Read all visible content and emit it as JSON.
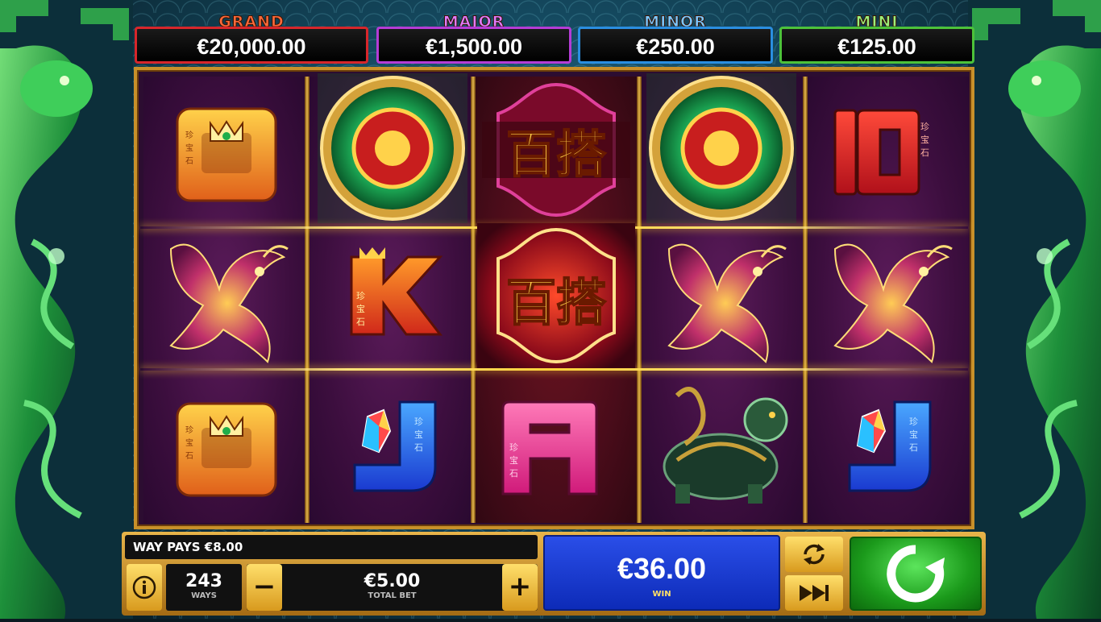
{
  "jackpots": [
    {
      "name": "GRAND",
      "value": "€20,000.00",
      "color": "#d7262b"
    },
    {
      "name": "MAJOR",
      "value": "€1,500.00",
      "color": "#b53cd6"
    },
    {
      "name": "MINOR",
      "value": "€250.00",
      "color": "#2a8ee0"
    },
    {
      "name": "MINI",
      "value": "€125.00",
      "color": "#4cc23a"
    }
  ],
  "reels": {
    "symbols": [
      [
        "Q",
        "phoenix",
        "Q"
      ],
      [
        "jade-coin",
        "K",
        "J"
      ],
      [
        "百搭",
        "百搭",
        "A"
      ],
      [
        "jade-coin",
        "phoenix",
        "dragon-turtle"
      ],
      [
        "10",
        "phoenix",
        "J"
      ]
    ],
    "wild_text": "百搭",
    "q_label": "Q",
    "k_label": "K",
    "j_label": "J",
    "a_label": "A",
    "ten_label": "10"
  },
  "message": "WAY PAYS €8.00",
  "ways": {
    "value": "243",
    "label": "WAYS"
  },
  "bet": {
    "value": "€5.00",
    "label": "TOTAL BET",
    "minus": "−",
    "plus": "+"
  },
  "win": {
    "value": "€36.00",
    "label": "WIN"
  },
  "icons": {
    "info": "info-icon",
    "autoplay": "autoplay-icon",
    "fast": "fast-forward-icon",
    "spin": "spin-icon"
  }
}
